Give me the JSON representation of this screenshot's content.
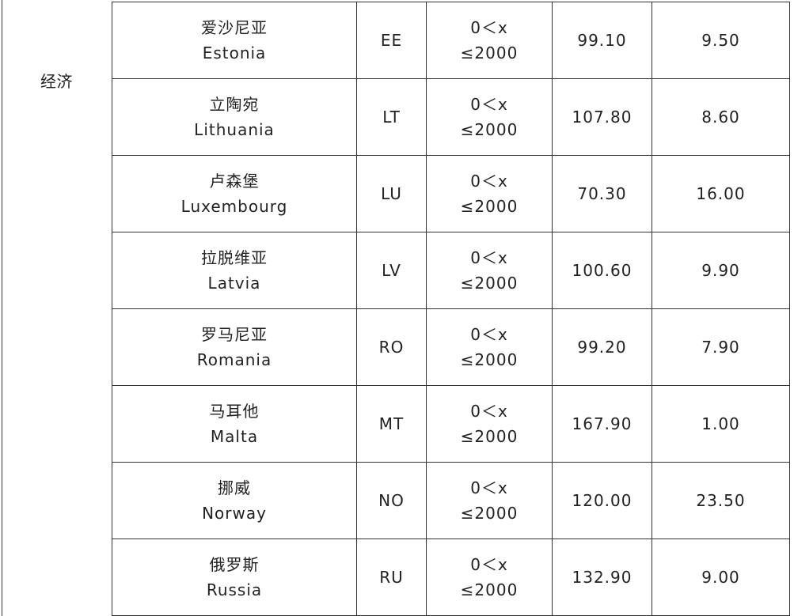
{
  "category": "经济",
  "rows": [
    {
      "name_cn": "爱沙尼亚",
      "name_en": "Estonia",
      "code": "EE",
      "range_line1": "0＜x",
      "range_line2": "≤2000",
      "value1": "99.10",
      "value2": "9.50"
    },
    {
      "name_cn": "立陶宛",
      "name_en": "Lithuania",
      "code": "LT",
      "range_line1": "0＜x",
      "range_line2": "≤2000",
      "value1": "107.80",
      "value2": "8.60"
    },
    {
      "name_cn": "卢森堡",
      "name_en": "Luxembourg",
      "code": "LU",
      "range_line1": "0＜x",
      "range_line2": "≤2000",
      "value1": "70.30",
      "value2": "16.00"
    },
    {
      "name_cn": "拉脱维亚",
      "name_en": "Latvia",
      "code": "LV",
      "range_line1": "0＜x",
      "range_line2": "≤2000",
      "value1": "100.60",
      "value2": "9.90"
    },
    {
      "name_cn": "罗马尼亚",
      "name_en": "Romania",
      "code": "RO",
      "range_line1": "0＜x",
      "range_line2": "≤2000",
      "value1": "99.20",
      "value2": "7.90"
    },
    {
      "name_cn": "马耳他",
      "name_en": "Malta",
      "code": "MT",
      "range_line1": "0＜x",
      "range_line2": "≤2000",
      "value1": "167.90",
      "value2": "1.00"
    },
    {
      "name_cn": "挪威",
      "name_en": "Norway",
      "code": "NO",
      "range_line1": "0＜x",
      "range_line2": "≤2000",
      "value1": "120.00",
      "value2": "23.50"
    },
    {
      "name_cn": "俄罗斯",
      "name_en": "Russia",
      "code": "RU",
      "range_line1": "0＜x",
      "range_line2": "≤2000",
      "value1": "132.90",
      "value2": "9.00"
    }
  ]
}
